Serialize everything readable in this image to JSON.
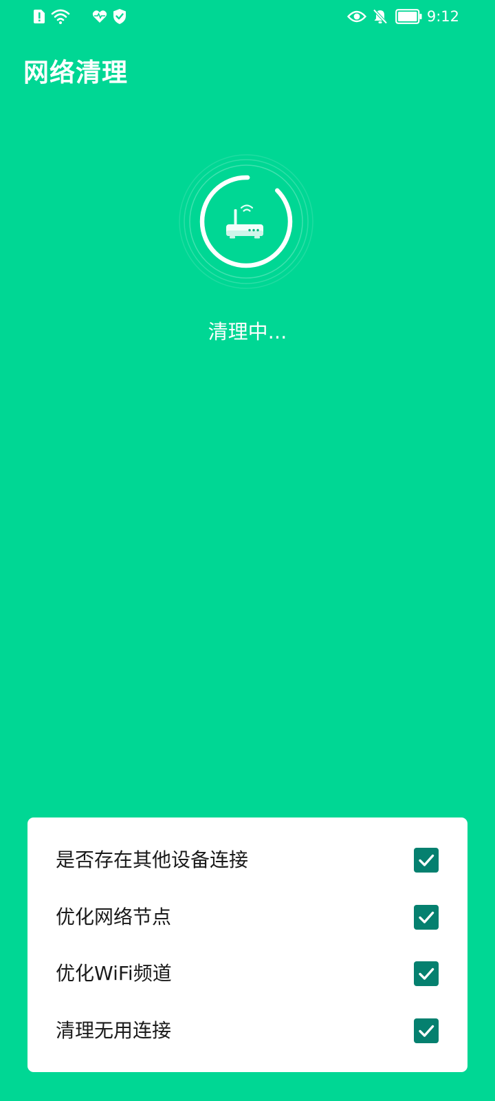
{
  "status_bar": {
    "time": "9:12",
    "icons_left": [
      "alert-sim-icon",
      "wifi-icon",
      "heart-health-icon",
      "shield-check-icon"
    ],
    "icons_right": [
      "eye-icon",
      "bell-off-icon",
      "battery-icon"
    ]
  },
  "header": {
    "title": "网络清理"
  },
  "progress": {
    "center_icon": "router-icon",
    "fraction": 0.88,
    "status_text": "清理中..."
  },
  "checklist": {
    "items": [
      {
        "label": "是否存在其他设备连接",
        "checked": true
      },
      {
        "label": "优化网络节点",
        "checked": true
      },
      {
        "label": "优化WiFi频道",
        "checked": true
      },
      {
        "label": "清理无用连接",
        "checked": true
      }
    ]
  },
  "colors": {
    "background": "#00D794",
    "card": "#FFFFFF",
    "checkbox": "#05806F",
    "text_dark": "#1A1A1A"
  }
}
